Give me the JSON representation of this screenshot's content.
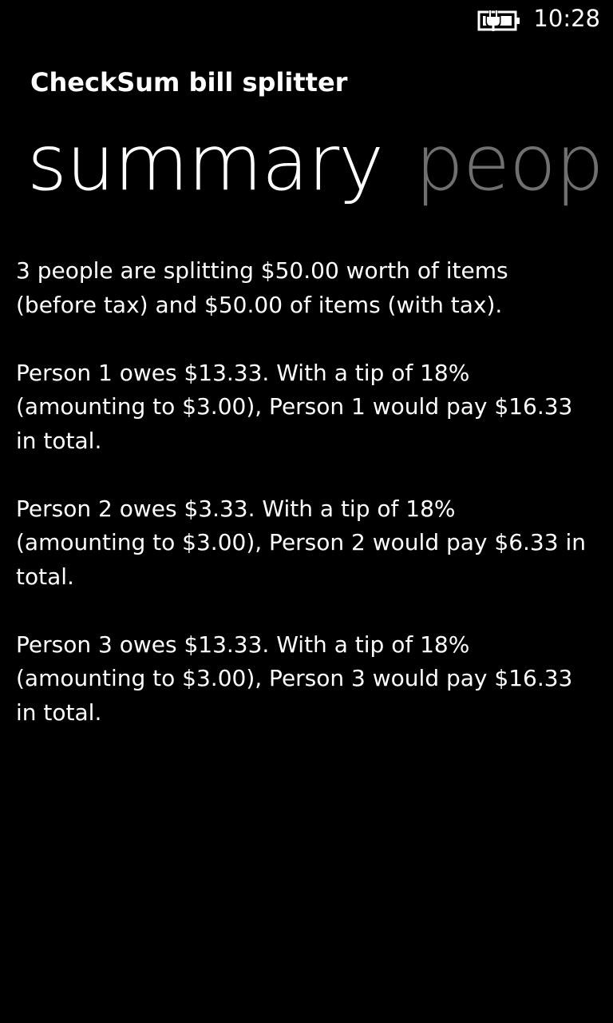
{
  "status_bar": {
    "time": "10:28",
    "battery_icon": "battery-charging-icon"
  },
  "app": {
    "title": "CheckSum bill splitter"
  },
  "pivot": {
    "items": [
      {
        "label": "summary",
        "active": true
      },
      {
        "label": "peop",
        "active": false
      }
    ]
  },
  "summary": {
    "intro": "3 people are splitting $50.00 worth of items (before tax) and $50.00 of items (with tax).",
    "people": [
      {
        "text": "Person 1 owes $13.33. With a tip of 18% (amounting to $3.00), Person 1 would pay $16.33 in total."
      },
      {
        "text": "Person 2 owes $3.33. With a tip of 18% (amounting to $3.00), Person 2 would pay $6.33 in total."
      },
      {
        "text": "Person 3 owes $13.33. With a tip of 18% (amounting to $3.00), Person 3 would pay $16.33 in total."
      }
    ]
  },
  "colors": {
    "background": "#000000",
    "foreground": "#ffffff",
    "inactive_pivot": "#707070"
  }
}
